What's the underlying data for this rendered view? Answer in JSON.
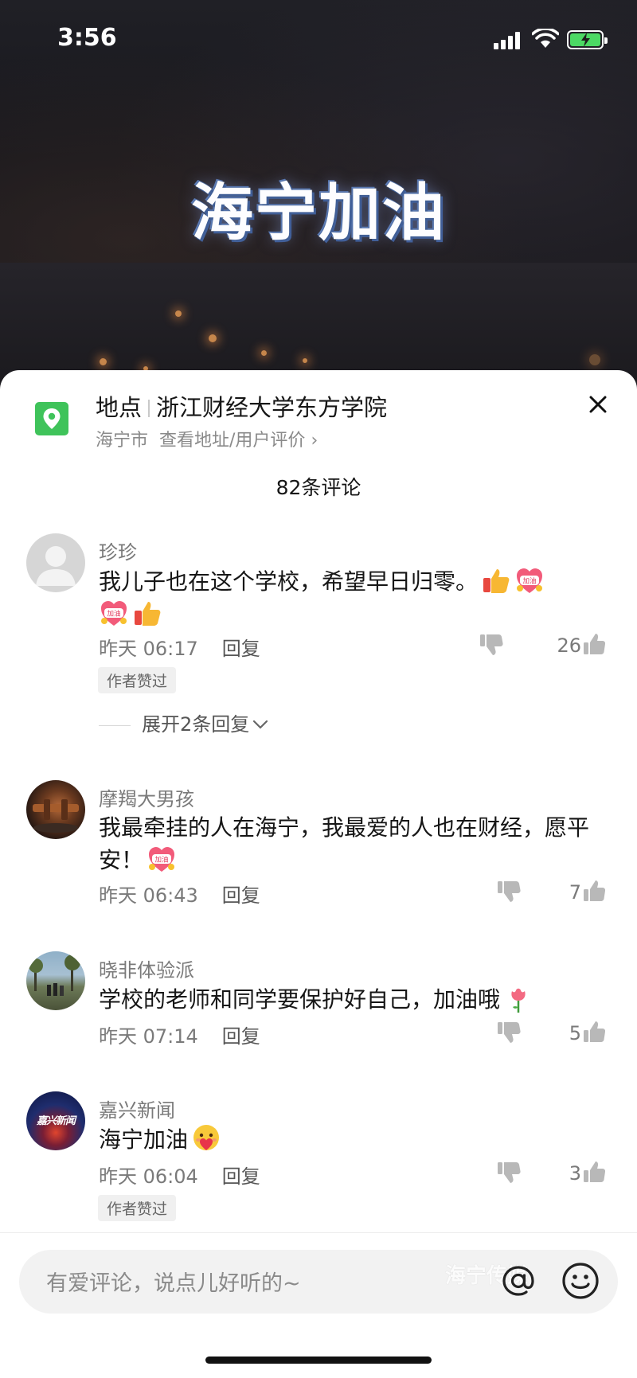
{
  "status_bar": {
    "time": "3:56"
  },
  "video": {
    "title": "海宁加油"
  },
  "location": {
    "label": "地点",
    "name": "浙江财经大学东方学院",
    "city": "海宁市",
    "link_text": "查看地址/用户评价",
    "chevron": "›"
  },
  "comments_header": {
    "count_text": "82条评论"
  },
  "comments": [
    {
      "username": "珍珍",
      "text": "我儿子也在这个学校，希望早日归零。",
      "emojis": [
        "thumbs-up",
        "jiayou-heart",
        "jiayou-heart",
        "thumbs-up"
      ],
      "time": "昨天 06:17",
      "reply": "回复",
      "likes": "26",
      "author_liked": "作者赞过",
      "expand_replies": "展开2条回复"
    },
    {
      "username": "摩羯大男孩",
      "text": "我最牵挂的人在海宁，我最爱的人也在财经，愿平安！",
      "emojis": [
        "jiayou-heart"
      ],
      "time": "昨天 06:43",
      "reply": "回复",
      "likes": "7"
    },
    {
      "username": "晓非体验派",
      "text": "学校的老师和同学要保护好自己，加油哦",
      "emojis": [
        "rose"
      ],
      "time": "昨天 07:14",
      "reply": "回复",
      "likes": "5"
    },
    {
      "username": "嘉兴新闻",
      "avatar_text": "嘉兴新闻",
      "text": "海宁加油",
      "emojis": [
        "hug-heart"
      ],
      "time": "昨天 06:04",
      "reply": "回复",
      "likes": "3",
      "author_liked": "作者赞过"
    }
  ],
  "input_bar": {
    "placeholder": "有爱评论，说点儿好听的~",
    "watermark": "海宁传媒"
  },
  "colors": {
    "location_pin": "#3fc35a",
    "sheet_bg": "#ffffff",
    "input_bg": "#f2f2f2",
    "thumb_icon": "#b8b8b8"
  }
}
